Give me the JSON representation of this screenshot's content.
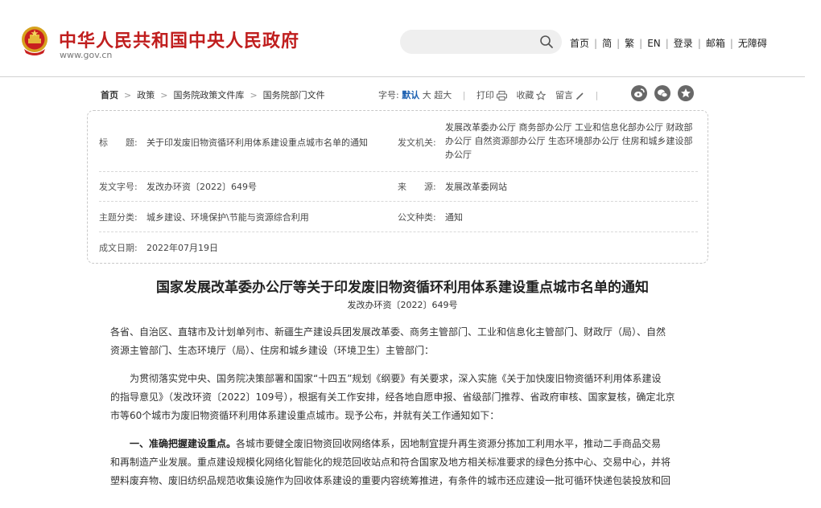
{
  "header": {
    "site_title": "中华人民共和国中央人民政府",
    "site_url": "www.gov.cn",
    "search_placeholder": "",
    "nav": [
      "首页",
      "简",
      "繁",
      "EN",
      "登录",
      "邮箱",
      "无障碍"
    ],
    "nav_separator": "|"
  },
  "breadcrumb": {
    "items": [
      "首页",
      "政策",
      "国务院政策文件库",
      "国务院部门文件"
    ],
    "arrow": ">"
  },
  "tools": {
    "font_size_label": "字号:",
    "font_sizes": [
      "默认",
      "大",
      "超大"
    ],
    "separator": "|",
    "print": "打印",
    "favorite": "收藏",
    "comment": "留言"
  },
  "meta": {
    "title_label": "标　　题:",
    "title_value": "关于印发废旧物资循环利用体系建设重点城市名单的通知",
    "issuer_label": "发文机关:",
    "issuer_lines": [
      "发展改革委办公厅  商务部办公厅  工业和信息化部办公厅  财政部",
      "办公厅  自然资源部办公厅  生态环境部办公厅  住房和城乡建设部",
      "办公厅"
    ],
    "docno_label": "发文字号:",
    "docno_value": "发改办环资〔2022〕649号",
    "source_label": "来　　源:",
    "source_value": "发展改革委网站",
    "category_label": "主题分类:",
    "category_value": "城乡建设、环境保护\\节能与资源综合利用",
    "type_label": "公文种类:",
    "type_value": "通知",
    "date_label": "成文日期:",
    "date_value": "2022年07月19日"
  },
  "article": {
    "title": "国家发展改革委办公厅等关于印发废旧物资循环利用体系建设重点城市名单的通知",
    "docno": "发改办环资〔2022〕649号",
    "para1_lines": [
      "各省、自治区、直辖市及计划单列市、新疆生产建设兵团发展改革委、商务主管部门、工业和信息化主管部门、财政厅（局）、自然",
      "资源主管部门、生态环境厅（局）、住房和城乡建设（环境卫生）主管部门："
    ],
    "para2_lines": [
      "　　为贯彻落实党中央、国务院决策部署和国家“十四五”规划《纲要》有关要求，深入实施《关于加快废旧物资循环利用体系建设",
      "的指导意见》（发改环资〔2022〕109号），根据有关工作安排，经各地自愿申报、省级部门推荐、省政府审核、国家复核，确定北京",
      "市等60个城市为废旧物资循环利用体系建设重点城市。现予公布，并就有关工作通知如下："
    ],
    "para3_lead": "　　一、准确把握建设重点。",
    "para3_lines": [
      "各城市要健全废旧物资回收网络体系，因地制宜提升再生资源分拣加工利用水平，推动二手商品交易",
      "和再制造产业发展。重点建设规模化网络化智能化的规范回收站点和符合国家及地方相关标准要求的绿色分拣中心、交易中心，并将",
      "塑料废弃物、废旧纺织品规范收集设施作为回收体系建设的重要内容统筹推进，有条件的城市还应建设一批可循环快递包装投放和回"
    ]
  },
  "colors": {
    "brand_red": "#c01e1e",
    "active_blue": "#1b5fb0"
  }
}
